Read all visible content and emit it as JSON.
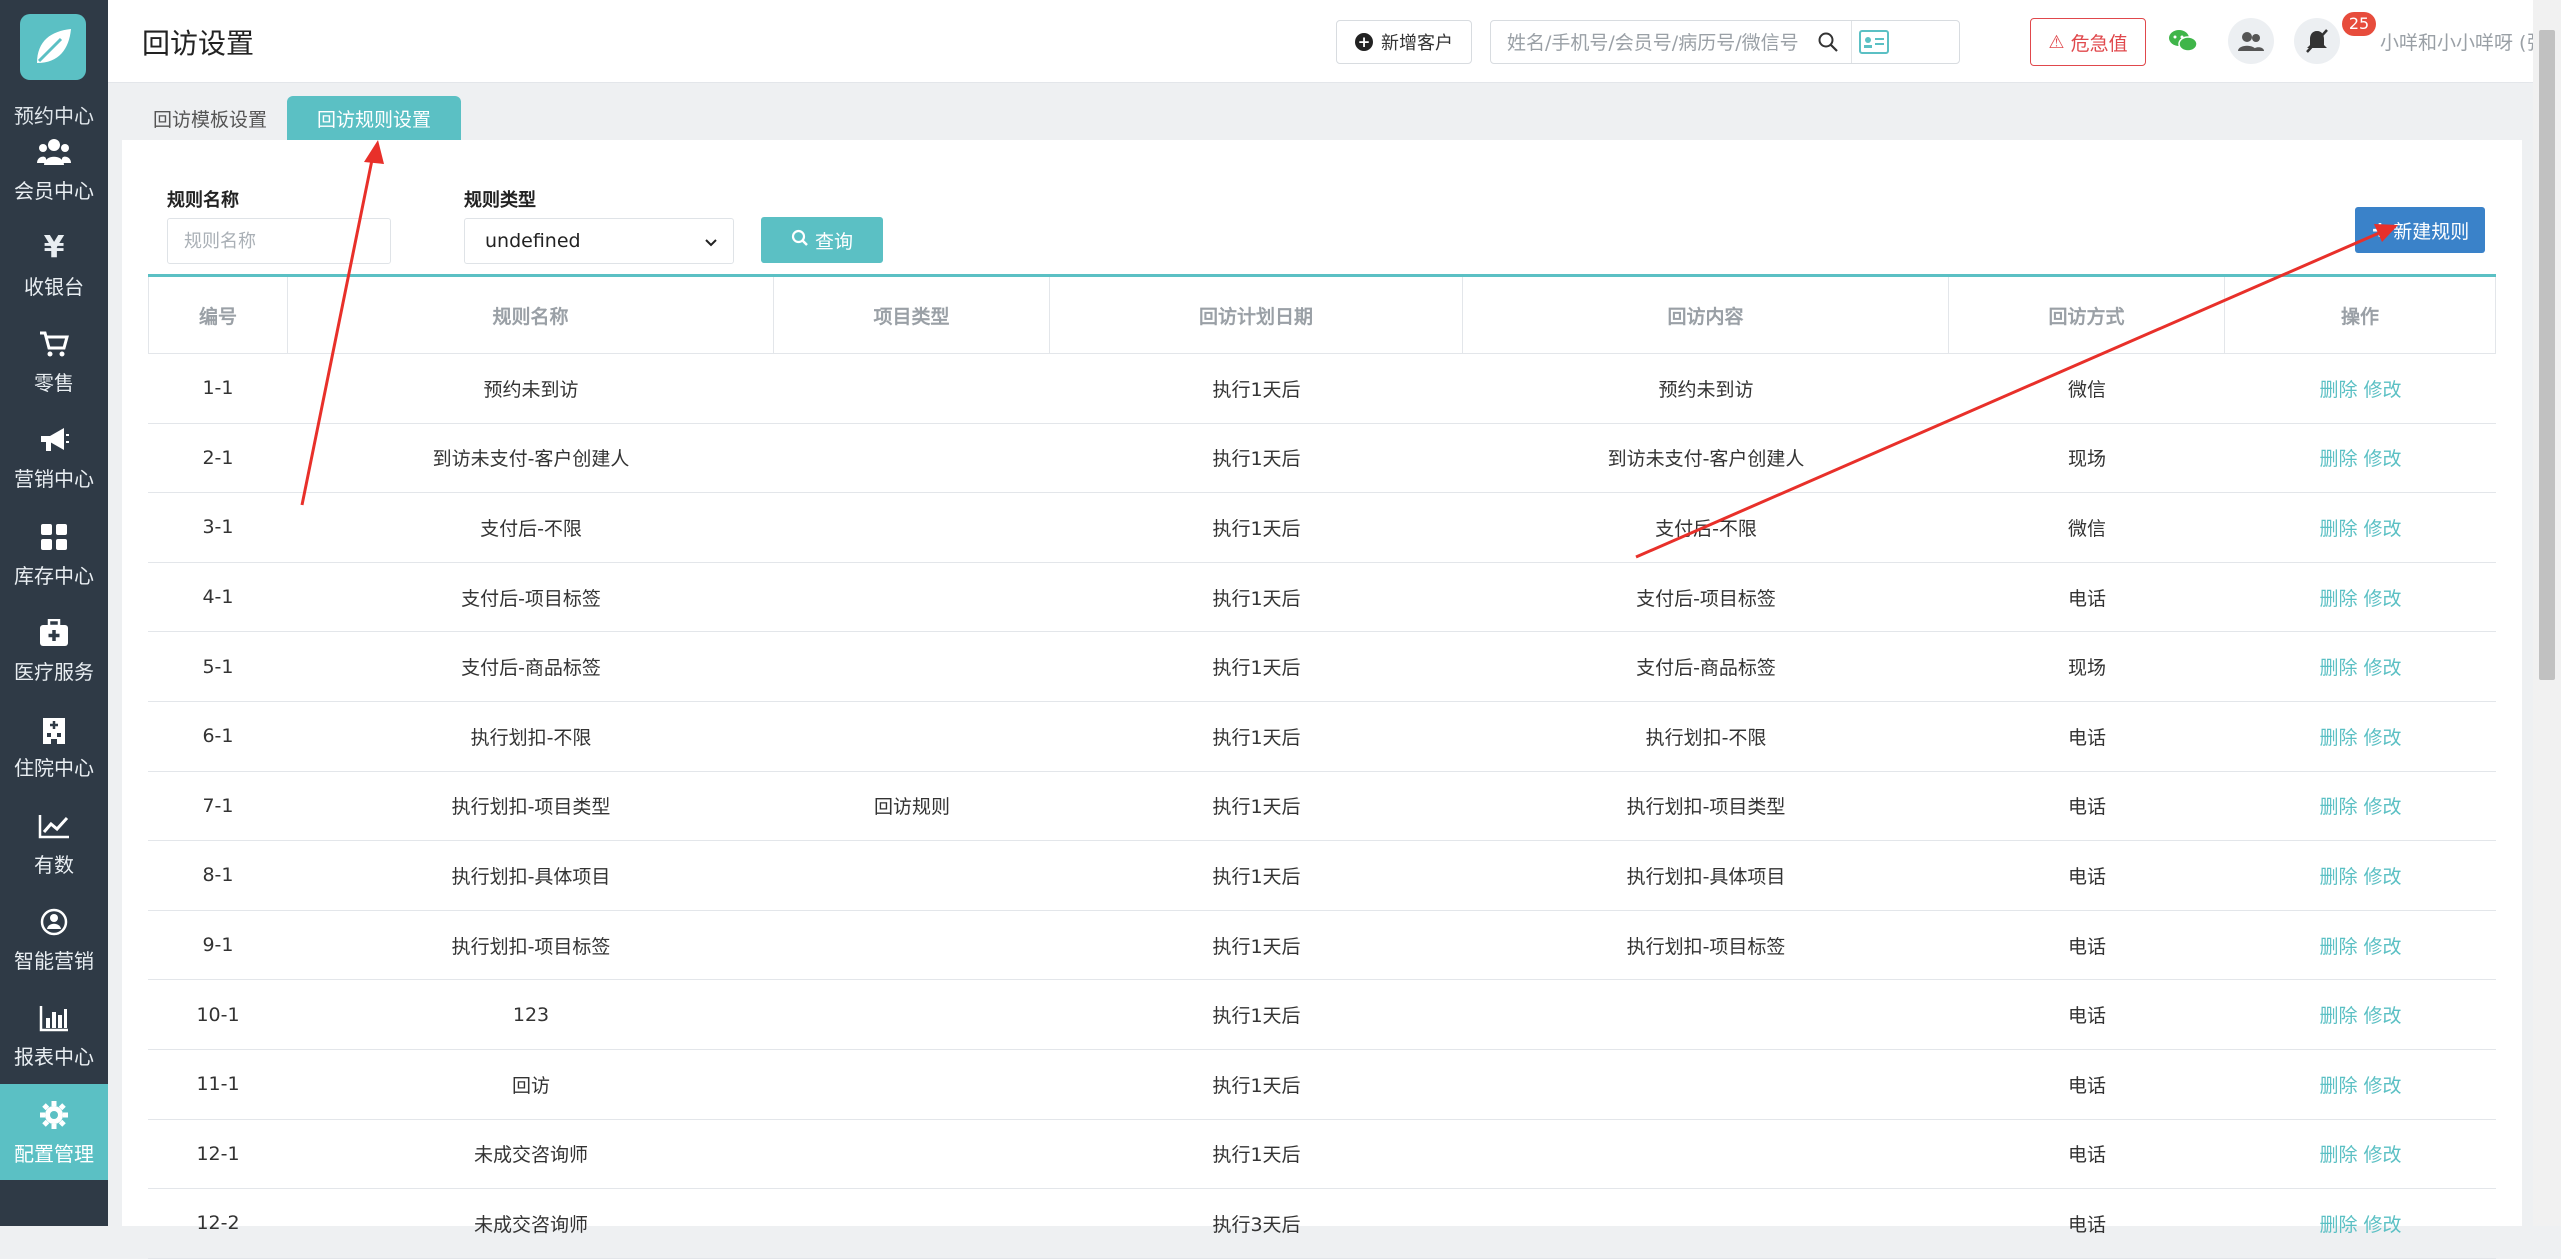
{
  "sidebar": {
    "clipped_label": "预约中心",
    "items": [
      {
        "label": "会员中心",
        "icon": "members-icon"
      },
      {
        "label": "收银台",
        "icon": "yen-icon"
      },
      {
        "label": "零售",
        "icon": "cart-icon"
      },
      {
        "label": "营销中心",
        "icon": "megaphone-icon"
      },
      {
        "label": "库存中心",
        "icon": "grid-icon"
      },
      {
        "label": "医疗服务",
        "icon": "medical-kit-icon"
      },
      {
        "label": "住院中心",
        "icon": "hospital-icon"
      },
      {
        "label": "有数",
        "icon": "trend-icon"
      },
      {
        "label": "智能营销",
        "icon": "smart-marketing-icon"
      },
      {
        "label": "报表中心",
        "icon": "bar-chart-icon"
      },
      {
        "label": "配置管理",
        "icon": "gear-icon",
        "active": true
      }
    ]
  },
  "header": {
    "title": "回访设置",
    "new_customer": "新增客户",
    "search_placeholder": "姓名/手机号/会员号/病历号/微信号",
    "critical_label": "危急值",
    "notification_count": "25",
    "user": "小咩和小小咩呀 (张江门诊部)"
  },
  "tabs": [
    {
      "label": "回访模板设置",
      "active": false
    },
    {
      "label": "回访规则设置",
      "active": true
    }
  ],
  "filters": {
    "rule_name_label": "规则名称",
    "rule_name_placeholder": "规则名称",
    "rule_type_label": "规则类型",
    "rule_type_value": "undefined",
    "query_button": "查询",
    "add_button": "新建规则"
  },
  "table": {
    "headers": [
      "编号",
      "规则名称",
      "项目类型",
      "回访计划日期",
      "回访内容",
      "回访方式",
      "操作"
    ],
    "delete_label": "删除",
    "edit_label": "修改",
    "rows": [
      [
        "1-1",
        "预约未到访",
        "",
        "执行1天后",
        "预约未到访",
        "微信"
      ],
      [
        "2-1",
        "到访未支付-客户创建人",
        "",
        "执行1天后",
        "到访未支付-客户创建人",
        "现场"
      ],
      [
        "3-1",
        "支付后-不限",
        "",
        "执行1天后",
        "支付后-不限",
        "微信"
      ],
      [
        "4-1",
        "支付后-项目标签",
        "",
        "执行1天后",
        "支付后-项目标签",
        "电话"
      ],
      [
        "5-1",
        "支付后-商品标签",
        "",
        "执行1天后",
        "支付后-商品标签",
        "现场"
      ],
      [
        "6-1",
        "执行划扣-不限",
        "",
        "执行1天后",
        "执行划扣-不限",
        "电话"
      ],
      [
        "7-1",
        "执行划扣-项目类型",
        "回访规则",
        "执行1天后",
        "执行划扣-项目类型",
        "电话"
      ],
      [
        "8-1",
        "执行划扣-具体项目",
        "",
        "执行1天后",
        "执行划扣-具体项目",
        "电话"
      ],
      [
        "9-1",
        "执行划扣-项目标签",
        "",
        "执行1天后",
        "执行划扣-项目标签",
        "电话"
      ],
      [
        "10-1",
        "123",
        "",
        "执行1天后",
        "",
        "电话"
      ],
      [
        "11-1",
        "回访",
        "",
        "执行1天后",
        "",
        "电话"
      ],
      [
        "12-1",
        "未成交咨询师",
        "",
        "执行1天后",
        "",
        "电话"
      ],
      [
        "12-2",
        "未成交咨询师",
        "",
        "执行3天后",
        "",
        "电话"
      ]
    ]
  },
  "colors": {
    "accent": "#5bc0c4",
    "sidebar_bg": "#2f3a46",
    "primary_button": "#3a82c9",
    "danger": "#e0484c",
    "annotation": "#e8302a"
  }
}
